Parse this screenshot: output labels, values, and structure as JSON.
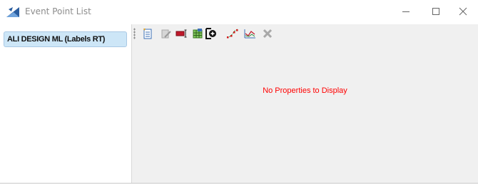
{
  "window": {
    "title": "Event Point List",
    "controls": [
      "minimize",
      "maximize",
      "close"
    ]
  },
  "tree": {
    "items": [
      {
        "label": "ALI DESIGN ML (Labels RT)",
        "selected": true
      }
    ]
  },
  "toolbar": {
    "buttons": [
      {
        "icon": "new-list-icon",
        "enabled": true
      },
      {
        "icon": "edit-icon",
        "enabled": false
      },
      {
        "icon": "rename-icon",
        "enabled": true
      },
      {
        "icon": "table-icon",
        "enabled": true
      },
      {
        "icon": "add-point-icon",
        "enabled": true
      },
      {
        "icon": "points-curve-icon",
        "enabled": true
      },
      {
        "icon": "profile-chart-icon",
        "enabled": true
      },
      {
        "icon": "delete-icon",
        "enabled": false
      }
    ]
  },
  "content": {
    "message": "No Properties to Display"
  },
  "colors": {
    "selection_fill": "#cde6f7",
    "message_text": "#ff0000",
    "pane_background": "#f0f0f0"
  }
}
